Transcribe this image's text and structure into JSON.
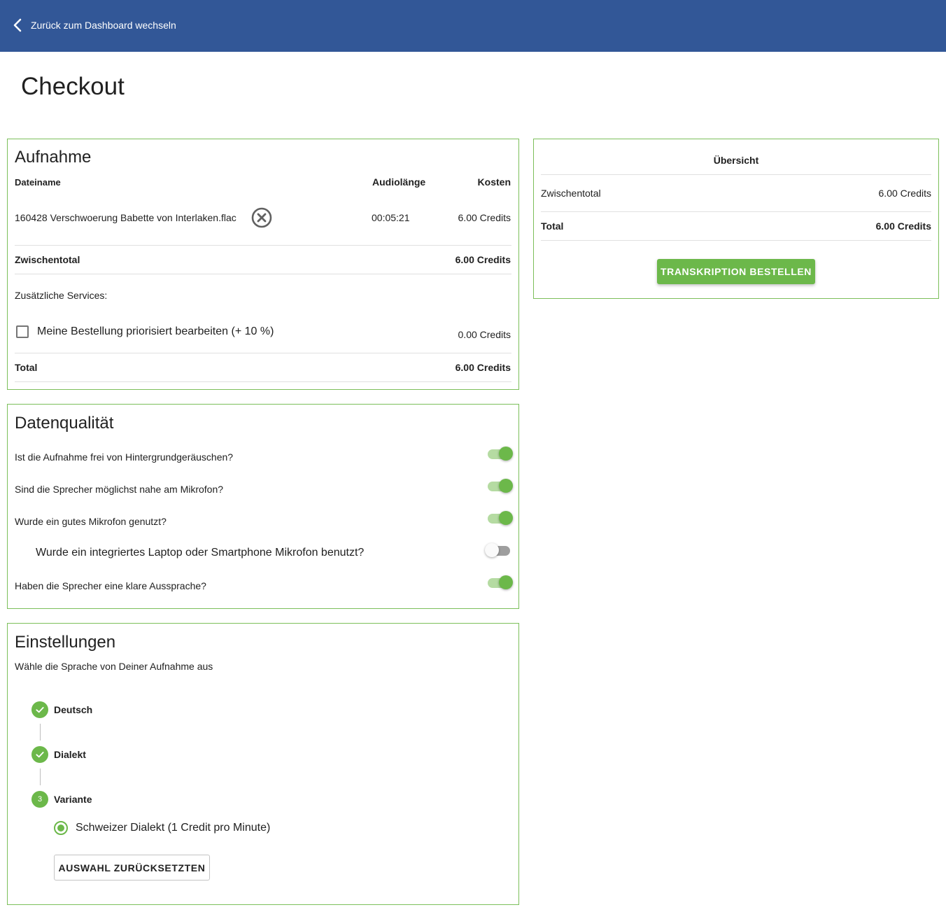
{
  "header": {
    "back_label": "Zurück zum Dashboard wechseln",
    "back_icon": "chevron-left-icon"
  },
  "page": {
    "title": "Checkout"
  },
  "recording": {
    "title": "Aufnahme",
    "columns": {
      "filename": "Dateiname",
      "duration": "Audiolänge",
      "cost": "Kosten"
    },
    "file": {
      "name": "160428 Verschwoerung Babette von Interlaken.flac",
      "duration": "00:05:21",
      "cost": "6.00 Credits",
      "remove_icon": "close-circle-icon"
    },
    "subtotal_label": "Zwischentotal",
    "subtotal_value": "6.00 Credits",
    "services_label": "Zusätzliche Services:",
    "priority": {
      "label": "Meine Bestellung priorisiert bearbeiten (+ 10 %)",
      "value": "0.00 Credits",
      "checked": false
    },
    "total_label": "Total",
    "total_value": "6.00 Credits"
  },
  "quality": {
    "title": "Datenqualität",
    "questions": [
      {
        "label": "Ist die Aufnahme frei von Hintergrundgeräuschen?",
        "on": true
      },
      {
        "label": "Sind die Sprecher möglichst nahe am Mikrofon?",
        "on": true
      },
      {
        "label": "Wurde ein gutes Mikrofon genutzt?",
        "on": true
      },
      {
        "label": "Wurde ein integriertes Laptop oder Smartphone Mikrofon benutzt?",
        "on": false
      },
      {
        "label": "Haben die Sprecher eine klare Aussprache?",
        "on": true
      }
    ]
  },
  "settings": {
    "title": "Einstellungen",
    "subtitle": "Wähle die Sprache von Deiner Aufnahme aus",
    "steps": [
      {
        "label": "Deutsch",
        "state": "done"
      },
      {
        "label": "Dialekt",
        "state": "done"
      },
      {
        "label": "Variante",
        "state": "active",
        "number": "3"
      }
    ],
    "option": {
      "label": "Schweizer Dialekt (1 Credit pro Minute)",
      "selected": true
    },
    "reset_label": "AUSWAHL ZURÜCKSETZTEN"
  },
  "summary": {
    "title": "Übersicht",
    "subtotal_label": "Zwischentotal",
    "subtotal_value": "6.00 Credits",
    "total_label": "Total",
    "total_value": "6.00 Credits",
    "order_label": "TRANSKRIPTION BESTELLEN"
  },
  "colors": {
    "header": "#325797",
    "accent": "#6cb84a",
    "card_border": "#7cbf5a"
  }
}
